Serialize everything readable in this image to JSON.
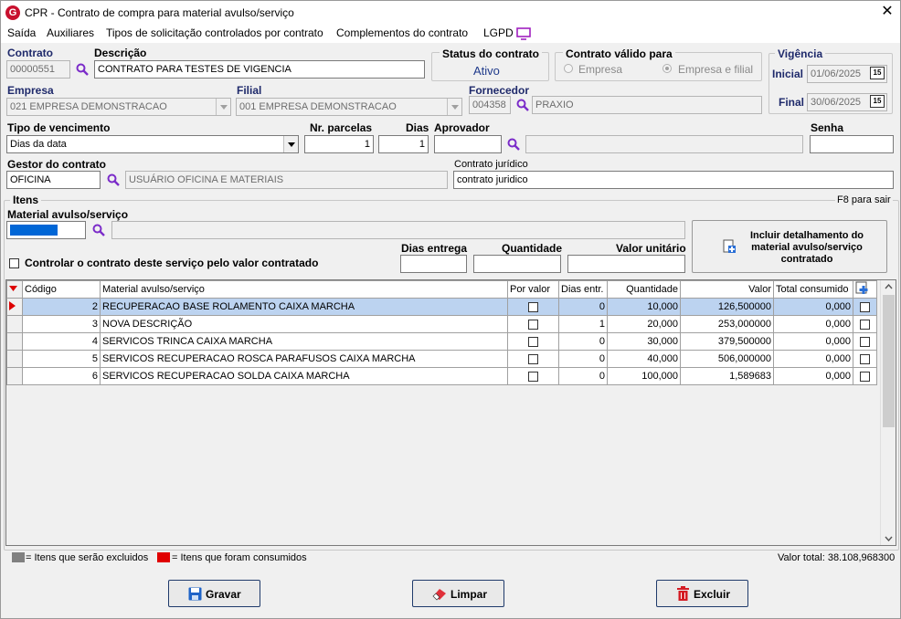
{
  "window": {
    "title": "CPR - Contrato de compra para material avulso/serviço",
    "close": "✕"
  },
  "menu": [
    "Saída",
    "Auxiliares",
    "Tipos de solicitação controlados por contrato",
    "Complementos do contrato",
    "LGPD"
  ],
  "contrato": {
    "label": "Contrato",
    "value": "00000551"
  },
  "descricao": {
    "label": "Descrição",
    "value": "CONTRATO PARA TESTES DE VIGENCIA"
  },
  "status": {
    "label": "Status do contrato",
    "value": "Ativo"
  },
  "valido_para": {
    "label": "Contrato válido para",
    "opt1": "Empresa",
    "opt2": "Empresa e filial",
    "selected": "Empresa e filial"
  },
  "vigencia": {
    "label": "Vigência",
    "inicial_label": "Inicial",
    "inicial": "01/06/2025",
    "final_label": "Final",
    "final": "30/06/2025",
    "cal_icon": "15"
  },
  "empresa": {
    "label": "Empresa",
    "value": "021 EMPRESA DEMONSTRACAO"
  },
  "filial": {
    "label": "Filial",
    "value": "001 EMPRESA DEMONSTRACAO"
  },
  "fornecedor": {
    "label": "Fornecedor",
    "code": "004358",
    "name": "PRAXIO"
  },
  "tipo_venc": {
    "label": "Tipo de vencimento",
    "value": "Dias da data"
  },
  "nr_parcelas": {
    "label": "Nr. parcelas",
    "value": "1"
  },
  "dias": {
    "label": "Dias",
    "value": "1"
  },
  "aprovador": {
    "label": "Aprovador",
    "value": ""
  },
  "senha": {
    "label": "Senha",
    "value": ""
  },
  "gestor": {
    "label": "Gestor do contrato",
    "code": "OFICINA",
    "name": "USUÁRIO OFICINA E MATERIAIS"
  },
  "juridico": {
    "label": "Contrato jurídico",
    "value": "contrato juridico"
  },
  "itens": {
    "label": "Itens",
    "hint": "F8 para sair"
  },
  "material": {
    "label": "Material avulso/serviço",
    "code": "",
    "name": ""
  },
  "controlar": {
    "label": "Controlar o contrato deste serviço pelo valor contratado"
  },
  "dias_entrega": {
    "label": "Dias entrega",
    "value": ""
  },
  "quantidade": {
    "label": "Quantidade",
    "value": ""
  },
  "valor_unit": {
    "label": "Valor unitário",
    "value": ""
  },
  "incluir_btn": "Incluir detalhamento do material avulso/serviço contratado",
  "table": {
    "headers": [
      "Código",
      "Material avulso/serviço",
      "Por valor",
      "Dias entr.",
      "Quantidade",
      "Valor",
      "Total consumido"
    ],
    "rows": [
      {
        "codigo": "2",
        "material": "RECUPERACAO BASE ROLAMENTO CAIXA MARCHA",
        "dias": "0",
        "qtd": "10,000",
        "valor": "126,500000",
        "total": "0,000"
      },
      {
        "codigo": "3",
        "material": "NOVA DESCRIÇÃO",
        "dias": "1",
        "qtd": "20,000",
        "valor": "253,000000",
        "total": "0,000"
      },
      {
        "codigo": "4",
        "material": "SERVICOS TRINCA CAIXA MARCHA",
        "dias": "0",
        "qtd": "30,000",
        "valor": "379,500000",
        "total": "0,000"
      },
      {
        "codigo": "5",
        "material": "SERVICOS RECUPERACAO ROSCA PARAFUSOS CAIXA MARCHA",
        "dias": "0",
        "qtd": "40,000",
        "valor": "506,000000",
        "total": "0,000"
      },
      {
        "codigo": "6",
        "material": "SERVICOS RECUPERACAO SOLDA CAIXA MARCHA",
        "dias": "0",
        "qtd": "100,000",
        "valor": "1,589683",
        "total": "0,000"
      }
    ]
  },
  "legend": {
    "excluidos": "= Itens que serão excluidos",
    "consumidos": "= Itens que foram consumidos",
    "gray": "#808080",
    "red": "#e00000"
  },
  "valor_total": "Valor total: 38.108,968300",
  "buttons": {
    "gravar": "Gravar",
    "limpar": "Limpar",
    "excluir": "Excluir"
  },
  "colors": {
    "accent": "#1f2a6b",
    "selection": "#bcd3f0",
    "search": "#7b2cc9"
  }
}
